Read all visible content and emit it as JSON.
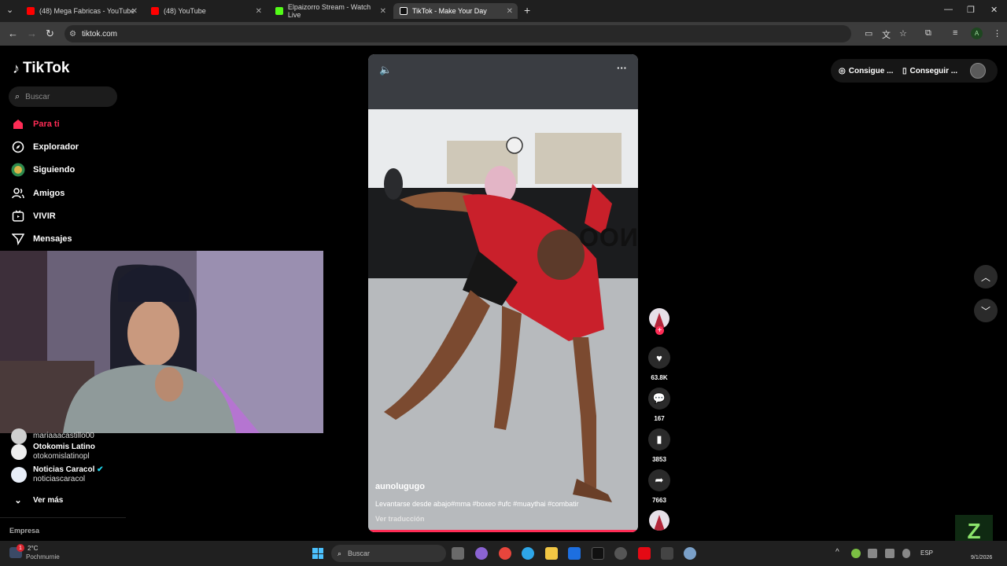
{
  "browser": {
    "tabs": [
      {
        "title": "(48) Mega Fabricas - YouTube",
        "icon": "youtube-icon"
      },
      {
        "title": "(48) YouTube",
        "icon": "youtube-icon"
      },
      {
        "title": "Elpaizorro Stream - Watch Live",
        "icon": "kick-icon"
      },
      {
        "title": "TikTok - Make Your Day",
        "icon": "tiktok-icon"
      }
    ],
    "url": "tiktok.com"
  },
  "sidebar": {
    "logo": "TikTok",
    "search_placeholder": "Buscar",
    "nav": [
      {
        "label": "Para ti",
        "icon": "home-icon",
        "active": true
      },
      {
        "label": "Explorador",
        "icon": "compass-icon"
      },
      {
        "label": "Siguiendo",
        "icon": "following-avatar"
      },
      {
        "label": "Amigos",
        "icon": "friends-icon"
      },
      {
        "label": "VIVIR",
        "icon": "live-icon"
      },
      {
        "label": "Mensajes",
        "icon": "message-icon"
      }
    ],
    "following": [
      {
        "name": "mariaaacastillo00",
        "handle": ""
      },
      {
        "name": "Otokomis Latino",
        "handle": "otokomislatinopl"
      },
      {
        "name": "Noticias Caracol",
        "handle": "noticiascaracol"
      }
    ],
    "see_more": "Ver más",
    "footer": "Empresa"
  },
  "video": {
    "author": "aunolugugo",
    "caption": "Levantarse desde abajo#mma #boxeo #ufc #muaythai #combatir",
    "translate": "Ver traducción",
    "gym_sign": "NOO",
    "likes": "63.8K",
    "comments": "167",
    "saves": "3853",
    "shares": "7663"
  },
  "header": {
    "coins_label": "Consigue ...",
    "app_label": "Conseguir ..."
  },
  "taskbar": {
    "search_placeholder": "Buscar",
    "weather_temp": "2°C",
    "weather_loc": "Pochmurnie",
    "lang": "ESP",
    "date": "9/1/2026",
    "badge": "1"
  },
  "colors": {
    "accent": "#fe2c55"
  }
}
